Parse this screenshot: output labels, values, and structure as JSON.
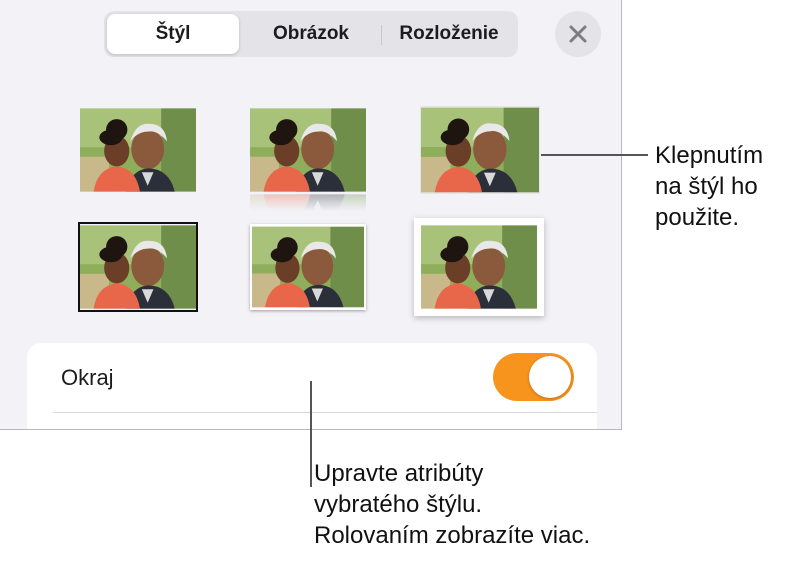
{
  "tabs": [
    {
      "label": "Štýl",
      "active": true
    },
    {
      "label": "Obrázok",
      "active": false
    },
    {
      "label": "Rozloženie",
      "active": false
    }
  ],
  "border_row": {
    "label": "Okraj",
    "toggle_on": true
  },
  "callouts": {
    "styles": [
      "Klepnutím",
      "na štýl ho",
      "použite."
    ],
    "attributes": [
      "Upravte atribúty",
      "vybratého štýlu.",
      "Rolovaním zobrazíte viac."
    ]
  },
  "colors": {
    "accent_toggle": "#f7941d",
    "panel_bg": "#f2f2f7"
  },
  "icons": [
    "close-icon"
  ]
}
